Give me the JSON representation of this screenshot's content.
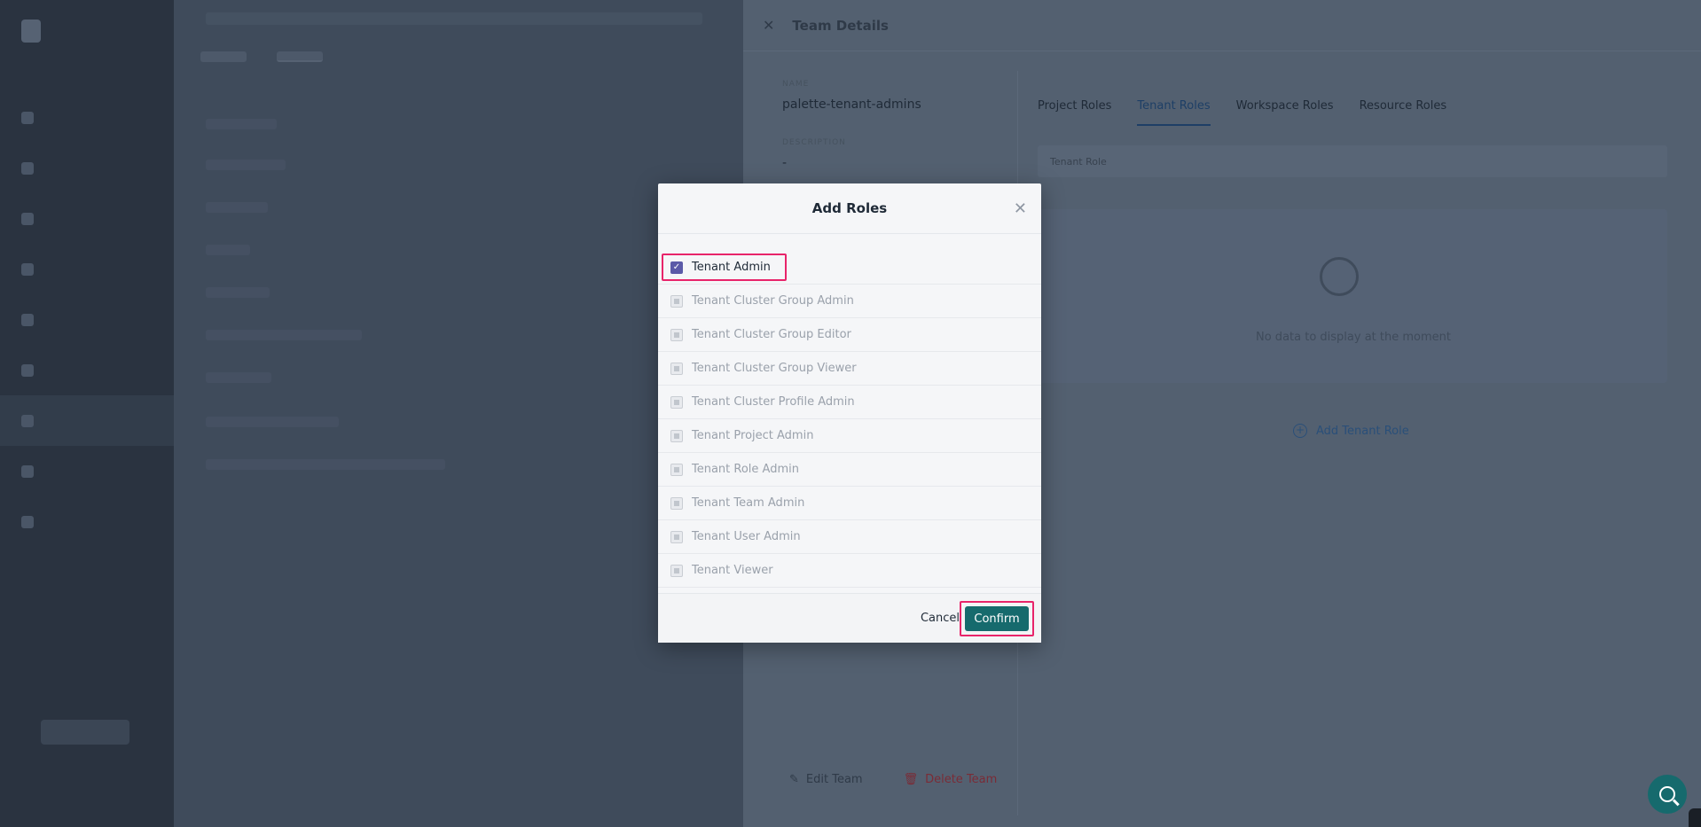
{
  "drawer": {
    "title": "Team Details",
    "close_icon": "close-icon",
    "name_caption": "NAME",
    "name_value": "palette-tenant-admins",
    "description_caption": "DESCRIPTION",
    "description_value": "-",
    "edit_label": "Edit Team",
    "delete_label": "Delete Team",
    "role_tabs": [
      {
        "label": "Project Roles",
        "active": false
      },
      {
        "label": "Tenant Roles",
        "active": true
      },
      {
        "label": "Workspace Roles",
        "active": false
      },
      {
        "label": "Resource Roles",
        "active": false
      }
    ],
    "table_header": "Tenant Role",
    "empty_text": "No data to display at the moment",
    "add_role_label": "Add Tenant Role"
  },
  "modal": {
    "title": "Add Roles",
    "roles": [
      {
        "label": "Tenant Admin",
        "checked": true
      },
      {
        "label": "Tenant Cluster Group Admin",
        "checked": false
      },
      {
        "label": "Tenant Cluster Group Editor",
        "checked": false
      },
      {
        "label": "Tenant Cluster Group Viewer",
        "checked": false
      },
      {
        "label": "Tenant Cluster Profile Admin",
        "checked": false
      },
      {
        "label": "Tenant Project Admin",
        "checked": false
      },
      {
        "label": "Tenant Role Admin",
        "checked": false
      },
      {
        "label": "Tenant Team Admin",
        "checked": false
      },
      {
        "label": "Tenant User Admin",
        "checked": false
      },
      {
        "label": "Tenant Viewer",
        "checked": false
      }
    ],
    "cancel_label": "Cancel",
    "confirm_label": "Confirm"
  },
  "colors": {
    "accent": "#166a6d",
    "highlight": "#e8246a",
    "checkbox": "#5b5aa8"
  }
}
